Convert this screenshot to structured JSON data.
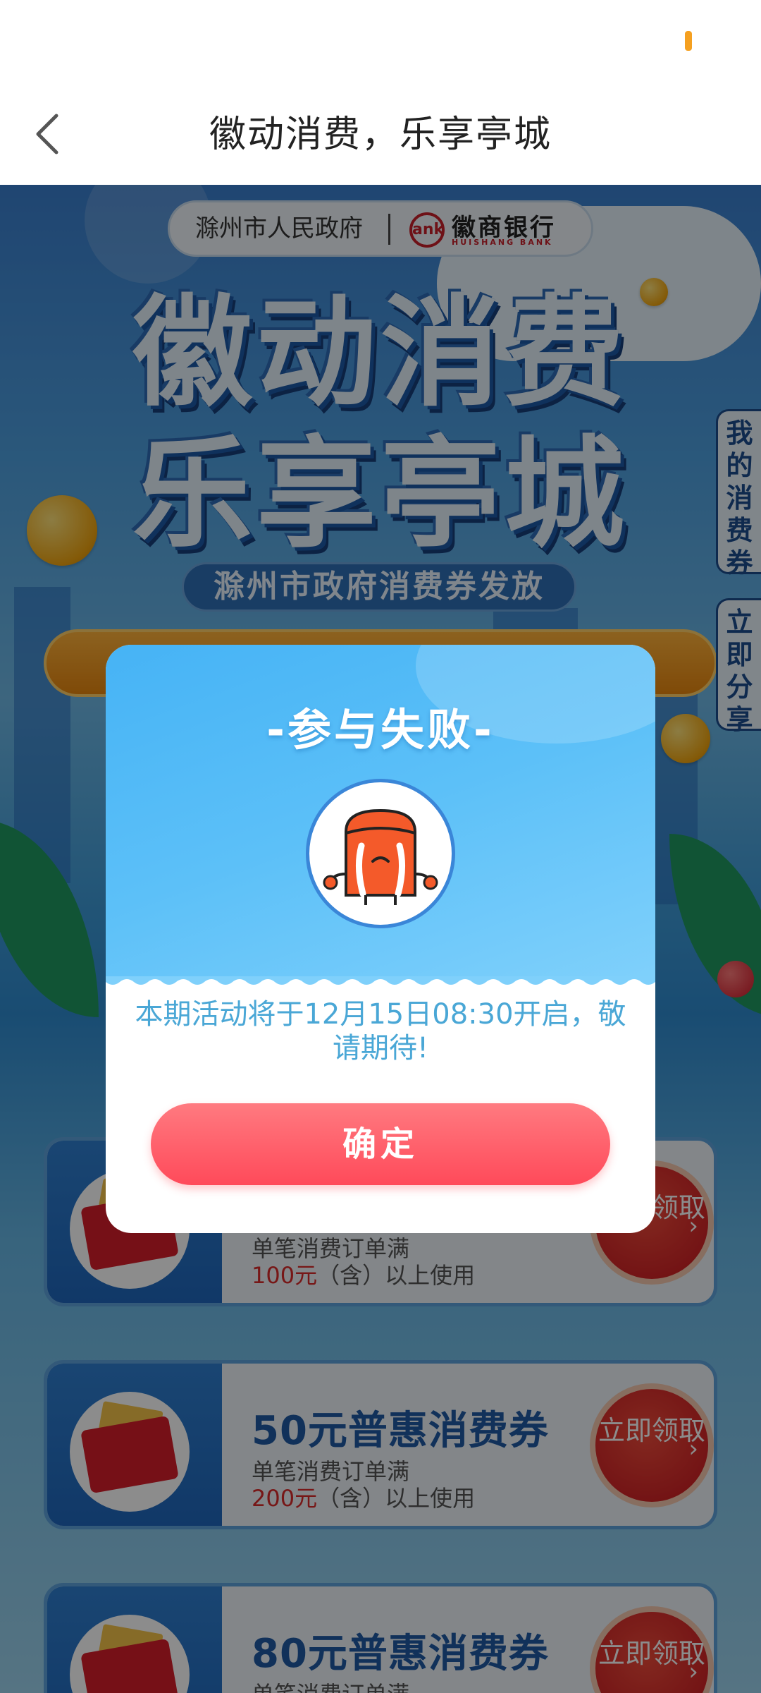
{
  "status_bar": {
    "battery_color": "#f5a020"
  },
  "header": {
    "title": "徽动消费，乐享亭城",
    "back_icon": "chevron-left-icon"
  },
  "banner": {
    "org": "滁州市人民政府",
    "bank_name": "徽商银行",
    "bank_en": "HUISHANG BANK",
    "bank_logo_text": "ank",
    "hero_line_1": "徽动消费",
    "hero_line_2": "乐享亭城",
    "subtitle": "滁州市政府消费券发放"
  },
  "side_tabs": {
    "my_coupons": "我的消费券",
    "share_now": "立即分享"
  },
  "coupons": [
    {
      "title": "",
      "desc": "单笔消费订单满",
      "min_amount": "100元",
      "min_suffix": "（含）以上使用",
      "claim": "立即领取"
    },
    {
      "title": "50元普惠消费券",
      "desc": "单笔消费订单满",
      "min_amount": "200元",
      "min_suffix": "（含）以上使用",
      "claim": "立即领取"
    },
    {
      "title": "80元普惠消费券",
      "desc": "单笔消费订单满",
      "min_amount": "",
      "min_suffix": "",
      "claim": "立即领取"
    }
  ],
  "modal": {
    "title": "-参与失败-",
    "message": "本期活动将于12月15日08:30开启，敬请期待!",
    "confirm_label": "确定",
    "avatar_icon": "crying-face-icon"
  },
  "colors": {
    "accent": "#ff4a5a",
    "modal_top": "#5cc0f8",
    "message": "#4aa7d6",
    "coupon_amount": "#d92b2b"
  }
}
